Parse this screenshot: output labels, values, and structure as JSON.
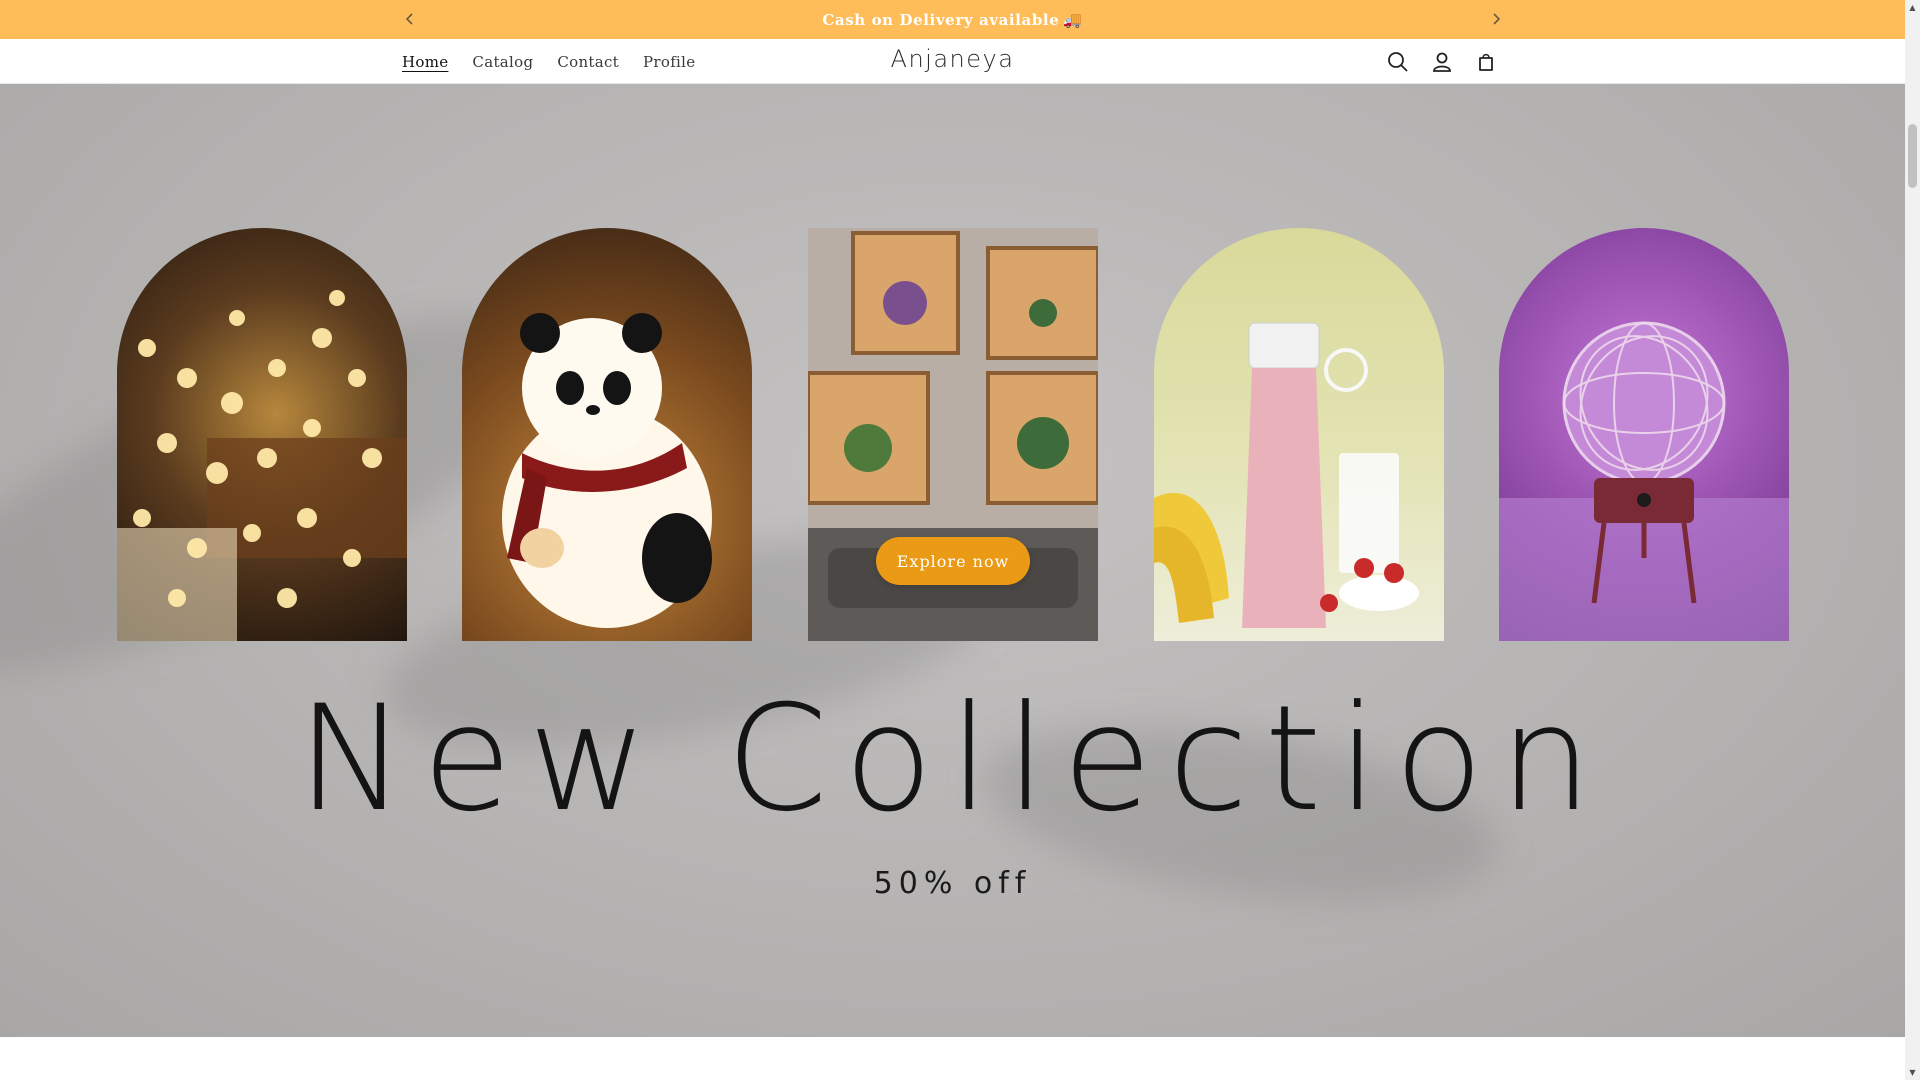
{
  "announcement": {
    "text": "Cash on Delivery available",
    "emoji": "🚚",
    "prev_icon": "chevron-left-icon",
    "next_icon": "chevron-right-icon"
  },
  "header": {
    "nav": [
      {
        "label": "Home",
        "active": true
      },
      {
        "label": "Catalog",
        "active": false
      },
      {
        "label": "Contact",
        "active": false
      },
      {
        "label": "Profile",
        "active": false
      }
    ],
    "logo": "Anjaneya",
    "icons": [
      "search-icon",
      "account-icon",
      "cart-icon"
    ]
  },
  "hero": {
    "button_label": "Explore now",
    "title": "New Collection",
    "subtitle": "50% off",
    "products": [
      "string-lights",
      "panda-lamp",
      "wall-shelves-plants",
      "portable-blender",
      "sphere-lamp"
    ]
  },
  "colors": {
    "announcement_bg": "#ffbd59",
    "button_bg": "#ea9a14",
    "hero_bg": "#b6b4b3"
  }
}
